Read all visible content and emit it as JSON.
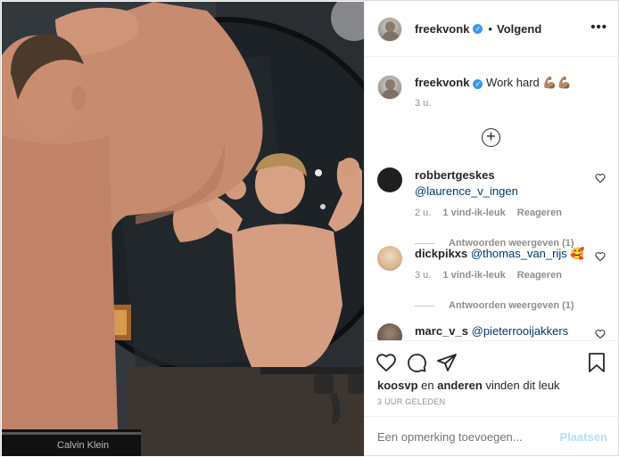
{
  "photo": {
    "brand_text": "Calvin Klein"
  },
  "header": {
    "username": "freekvonk",
    "separator": "•",
    "follow_label": "Volgend",
    "more_label": "•••"
  },
  "caption": {
    "username": "freekvonk",
    "text": "Work hard 💪🏽💪🏽",
    "time": "3 u."
  },
  "load_more_label": "+",
  "comments": [
    {
      "username": "robbertgeskes",
      "mention": "@laurence_v_ingen",
      "emoji": "",
      "time": "2 u.",
      "likes": "1 vind-ik-leuk",
      "reply": "Reageren",
      "view_replies": "Antwoorden weergeven (1)",
      "avatar_color": "#1f1f1f"
    },
    {
      "username": "dickpikxs",
      "mention": "@thomas_van_rijs",
      "emoji": "🥰",
      "time": "3 u.",
      "likes": "1 vind-ik-leuk",
      "reply": "Reageren",
      "view_replies": "Antwoorden weergeven (1)",
      "avatar_color": "#d9c7b0"
    },
    {
      "username": "marc_v_s",
      "mention": "@pieterrooijakkers",
      "emoji": "",
      "avatar_color": "#6b5a4e"
    }
  ],
  "likes_line": {
    "user": "koosvp",
    "middle": "en",
    "others": "anderen",
    "suffix": "vinden dit leuk"
  },
  "posted_ago": "3 UUR GELEDEN",
  "add_comment": {
    "placeholder": "Een opmerking toevoegen...",
    "post_label": "Plaatsen"
  },
  "colors": {
    "link": "#00376b",
    "verified": "#3897f0",
    "post_disabled": "#b2dffc",
    "meta_gray": "#8e8e8e"
  },
  "icons": [
    "heart-icon",
    "comment-icon",
    "share-icon",
    "bookmark-icon",
    "verified-badge-icon",
    "add-circle-icon"
  ]
}
